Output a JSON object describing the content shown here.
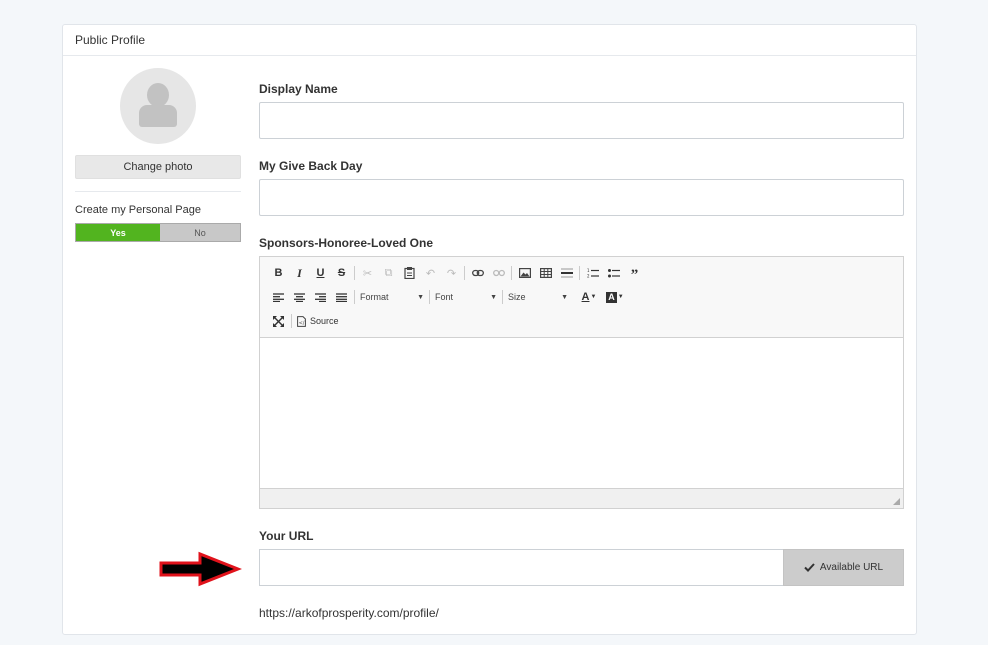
{
  "card": {
    "title": "Public Profile"
  },
  "left": {
    "change_photo_label": "Change photo",
    "personal_page_label": "Create my Personal Page",
    "toggle": {
      "yes_label": "Yes",
      "no_label": "No",
      "selected": "Yes"
    }
  },
  "fields": {
    "display_name": {
      "label": "Display Name",
      "value": "",
      "placeholder": ""
    },
    "give_back_day": {
      "label": "My Give Back Day",
      "value": "",
      "placeholder": ""
    },
    "sponsors": {
      "label": "Sponsors-Honoree-Loved One"
    }
  },
  "editor": {
    "row1": [
      "bold-icon",
      "italic-icon",
      "underline-icon",
      "strikethrough-icon",
      "cut-icon",
      "copy-icon",
      "paste-icon",
      "undo-icon",
      "redo-icon",
      "link-icon",
      "unlink-icon",
      "image-icon",
      "table-icon",
      "horizontal-line-icon",
      "numbered-list-icon",
      "bulleted-list-icon",
      "blockquote-icon"
    ],
    "format_label": "Format",
    "font_label": "Font",
    "size_label": "Size",
    "source_label": "Source"
  },
  "url": {
    "label": "Your URL",
    "value": "",
    "button_label": "Available URL",
    "hint": "https://arkofprosperity.com/profile/"
  },
  "colors": {
    "accent_green": "#52b41f",
    "arrow_red": "#e0121b"
  }
}
